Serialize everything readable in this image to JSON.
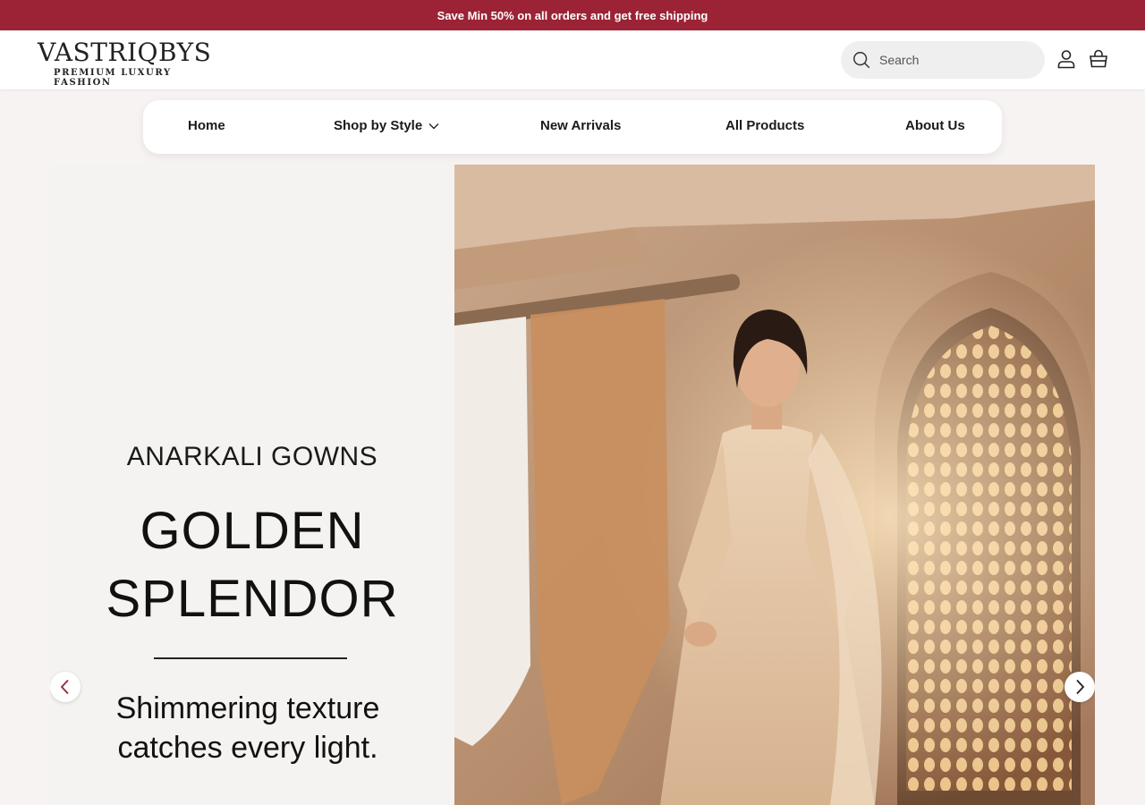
{
  "announcement": {
    "text": "Save Min 50% on all orders and get free shipping"
  },
  "header": {
    "logo_main": "VASTRIQBYS",
    "logo_sub": "PREMIUM LUXURY FASHION",
    "search_placeholder": "Search",
    "icons": [
      "search-icon",
      "account-icon",
      "cart-icon"
    ]
  },
  "nav": {
    "items": [
      {
        "label": "Home"
      },
      {
        "label": "Shop by Style",
        "icon": "chevron-down-icon"
      },
      {
        "label": "New Arrivals"
      },
      {
        "label": "All Products"
      },
      {
        "label": "About Us"
      }
    ]
  },
  "hero": {
    "eyebrow": "ANARKALI GOWNS",
    "title_line1": "GOLDEN",
    "title_line2": "SPLENDOR",
    "tagline_line1": "Shimmering texture",
    "tagline_line2": "catches every light.",
    "icons": [
      "chevron-left-icon",
      "chevron-right-icon"
    ]
  },
  "colors": {
    "announcement_bg": "#9b2335",
    "page_bg": "#f6f3f2",
    "hero_left_bg": "#f4f3f1"
  }
}
